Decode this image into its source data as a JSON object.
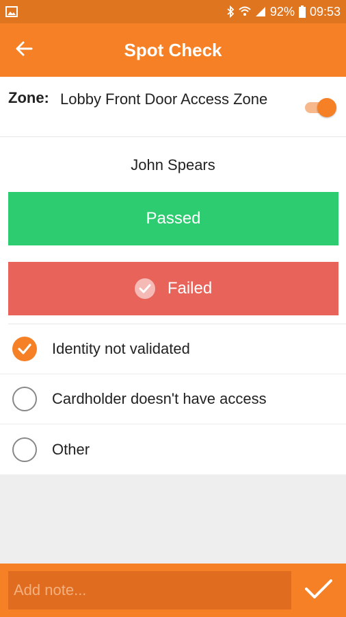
{
  "status_bar": {
    "battery": "92%",
    "time": "09:53",
    "icons": [
      "image-notification-icon",
      "bluetooth-icon",
      "wifi-icon",
      "signal-icon",
      "battery-icon"
    ]
  },
  "app_bar": {
    "title": "Spot Check",
    "back_icon": "arrow-left-icon"
  },
  "zone": {
    "label": "Zone:",
    "value": "Lobby Front Door Access Zone",
    "toggle_on": true
  },
  "person": {
    "name": "John Spears"
  },
  "result_buttons": {
    "passed": "Passed",
    "failed": "Failed",
    "selected": "failed"
  },
  "failure_reasons": [
    {
      "label": "Identity not validated",
      "checked": true
    },
    {
      "label": "Cardholder doesn't have access",
      "checked": false
    },
    {
      "label": "Other",
      "checked": false
    }
  ],
  "note": {
    "placeholder": "Add note...",
    "value": ""
  },
  "colors": {
    "accent": "#f58025",
    "status_bar": "#e07520",
    "passed": "#2ecc71",
    "failed": "#e8635a"
  }
}
